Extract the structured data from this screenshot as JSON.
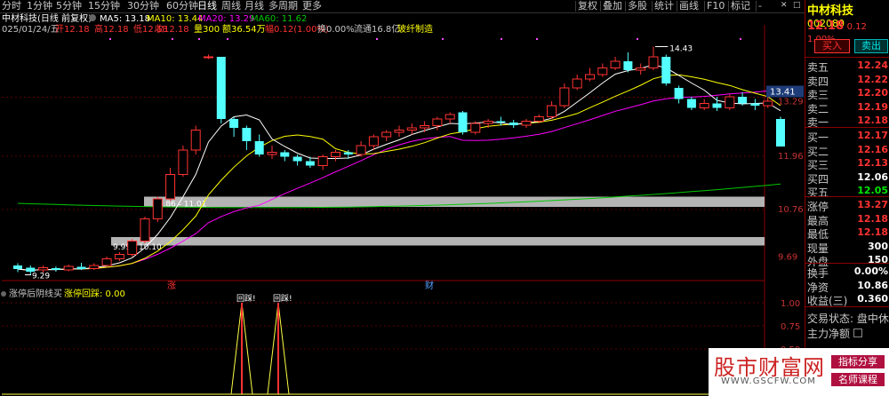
{
  "toolbar": {
    "periods": [
      "分时",
      "1分钟",
      "5分钟",
      "15分钟",
      "30分钟",
      "60分钟",
      "日线",
      "周线",
      "月线",
      "多周期",
      "更多"
    ],
    "active_period": "日线",
    "right_items": [
      "复权",
      "叠加",
      "多股",
      "统计",
      "画线",
      "F10",
      "标记",
      "-"
    ]
  },
  "stock": {
    "name": "中材科技",
    "code": "002080",
    "price": "12.18",
    "change": "0.12",
    "pct": "1.00%"
  },
  "header": {
    "title_line": "中材科技(日线 前复权)",
    "ma5": "MA5: 13.18",
    "ma10": "MA10: 13.44",
    "ma20": "MA20: 13.29",
    "ma60": "MA60: 11.62",
    "ohlc_date": "025/01/24/五",
    "ohlc_open": "开12.18",
    "ohlc_high": "高12.18",
    "ohlc_low": "低12.18",
    "ohlc_close": "收12.18",
    "ohlc_vol": "量300",
    "ohlc_amount": "额36.54万",
    "ohlc_amp": "幅0.12(1.00%)",
    "ohlc_turnover": "换0.00%",
    "ohlc_float": "流通16.8亿",
    "ohlc_sector": "玻纤制造"
  },
  "chart_labels": {
    "y_ticks": [
      "13.41",
      "13.29",
      "11.96",
      "10.76",
      "9.69"
    ],
    "high_label": "14.43",
    "low_label": "9.29",
    "zone_upper": "10.86 - 11.01",
    "zone_lower": "9.99 - 10.10",
    "marker_zhang": "涨",
    "marker_cai": "财",
    "indicator_name": "涨停后阴线买",
    "indicator_value": "涨停回踩: 0.00",
    "ind_ticks": [
      "1.00",
      "0.75",
      "0.50"
    ],
    "signal1": "回踩!",
    "signal2": "回踩!"
  },
  "colors": {
    "up": "#ff3232",
    "down": "#54ffff",
    "ma5": "#ffffff",
    "ma10": "#ffff00",
    "ma20": "#ff00ff",
    "ma60": "#00c800",
    "zone": "#b4b4b4"
  },
  "panel": {
    "buy_btn": "买入",
    "sell_btn": "卖出",
    "asks": [
      {
        "label": "卖五",
        "price": "12.24"
      },
      {
        "label": "卖四",
        "price": "12.22"
      },
      {
        "label": "卖三",
        "price": "12.20"
      },
      {
        "label": "卖二",
        "price": "12.19"
      },
      {
        "label": "卖一",
        "price": "12.18"
      }
    ],
    "bids": [
      {
        "label": "买一",
        "price": "12.17"
      },
      {
        "label": "买二",
        "price": "12.16"
      },
      {
        "label": "买三",
        "price": "12.13"
      },
      {
        "label": "买四",
        "price": "12.06"
      },
      {
        "label": "买五",
        "price": "12.05"
      }
    ],
    "stats": [
      {
        "label": "涨停",
        "value": "13.27"
      },
      {
        "label": "最高",
        "value": "12.18"
      },
      {
        "label": "最低",
        "value": "12.18"
      },
      {
        "label": "现量",
        "value": "300"
      },
      {
        "label": "外盘",
        "value": "150"
      }
    ],
    "stats2": [
      {
        "label": "换手",
        "value": "0.00%"
      },
      {
        "label": "净资",
        "value": "10.86"
      },
      {
        "label": "收益(三)",
        "value": "0.360"
      }
    ],
    "trade_status": "交易状态: 盘中休",
    "main_net": "主力净额"
  },
  "watermark": {
    "title": "股市财富网",
    "url": "WWW.GSCFW.COM",
    "tag1": "指标分享",
    "tag2": "名师课程"
  },
  "chart_data": {
    "type": "candlestick",
    "candles": [
      [
        9.5,
        9.42,
        9.55,
        9.35
      ],
      [
        9.45,
        9.36,
        9.5,
        9.29
      ],
      [
        9.4,
        9.45,
        9.5,
        9.34
      ],
      [
        9.44,
        9.4,
        9.48,
        9.36
      ],
      [
        9.4,
        9.48,
        9.52,
        9.37
      ],
      [
        9.47,
        9.42,
        9.56,
        9.4
      ],
      [
        9.43,
        9.5,
        9.55,
        9.4
      ],
      [
        9.5,
        9.65,
        9.7,
        9.48
      ],
      [
        9.65,
        9.75,
        9.8,
        9.6
      ],
      [
        9.75,
        10.05,
        10.1,
        9.7
      ],
      [
        10.05,
        10.55,
        10.6,
        10.0
      ],
      [
        10.55,
        11.0,
        11.05,
        10.48
      ],
      [
        11.0,
        11.55,
        11.7,
        10.95
      ],
      [
        11.55,
        12.1,
        12.2,
        11.5
      ],
      [
        12.1,
        12.55,
        12.65,
        12.0
      ],
      [
        14.2,
        14.2,
        14.25,
        14.15
      ],
      [
        14.2,
        12.8,
        14.05,
        12.7
      ],
      [
        12.8,
        12.6,
        12.85,
        12.4
      ],
      [
        12.6,
        12.3,
        12.65,
        12.1
      ],
      [
        12.3,
        12.0,
        12.45,
        11.95
      ],
      [
        12.0,
        12.05,
        12.2,
        11.9
      ],
      [
        12.05,
        11.95,
        12.1,
        11.85
      ],
      [
        11.95,
        11.85,
        12.0,
        11.75
      ],
      [
        11.85,
        11.75,
        11.95,
        11.7
      ],
      [
        11.75,
        11.95,
        12.0,
        11.65
      ],
      [
        11.95,
        12.05,
        12.1,
        11.85
      ],
      [
        12.05,
        12.0,
        12.1,
        11.9
      ],
      [
        12.0,
        12.2,
        12.3,
        11.95
      ],
      [
        12.2,
        12.4,
        12.45,
        12.1
      ],
      [
        12.4,
        12.5,
        12.55,
        12.3
      ],
      [
        12.5,
        12.55,
        12.65,
        12.4
      ],
      [
        12.55,
        12.6,
        12.7,
        12.45
      ],
      [
        12.6,
        12.65,
        12.75,
        12.5
      ],
      [
        12.65,
        12.8,
        12.85,
        12.55
      ],
      [
        12.8,
        12.9,
        12.95,
        12.7
      ],
      [
        12.95,
        12.5,
        12.98,
        12.45
      ],
      [
        12.5,
        12.7,
        12.75,
        12.45
      ],
      [
        12.7,
        12.75,
        12.8,
        12.6
      ],
      [
        12.75,
        12.72,
        12.85,
        12.65
      ],
      [
        12.72,
        12.66,
        12.78,
        12.6
      ],
      [
        12.66,
        12.75,
        12.8,
        12.6
      ],
      [
        12.75,
        12.85,
        12.9,
        12.7
      ],
      [
        12.85,
        13.1,
        13.2,
        12.8
      ],
      [
        13.1,
        13.5,
        13.6,
        13.05
      ],
      [
        13.5,
        13.7,
        13.8,
        13.45
      ],
      [
        13.7,
        13.8,
        13.95,
        13.65
      ],
      [
        13.8,
        13.95,
        14.05,
        13.75
      ],
      [
        13.95,
        14.1,
        14.2,
        13.9
      ],
      [
        14.1,
        13.9,
        14.3,
        13.85
      ],
      [
        13.9,
        13.95,
        14.05,
        13.8
      ],
      [
        13.95,
        14.2,
        14.43,
        13.9
      ],
      [
        14.2,
        13.6,
        14.25,
        13.55
      ],
      [
        13.5,
        13.25,
        13.55,
        13.15
      ],
      [
        13.25,
        13.05,
        13.3,
        13.0
      ],
      [
        13.05,
        13.15,
        13.25,
        13.0
      ],
      [
        13.15,
        13.05,
        13.3,
        12.98
      ],
      [
        13.05,
        13.3,
        13.35,
        13.0
      ],
      [
        13.3,
        13.15,
        13.4,
        13.1
      ],
      [
        13.15,
        13.1,
        13.25,
        13.0
      ],
      [
        13.1,
        13.2,
        13.35,
        13.05
      ],
      [
        12.8,
        12.18,
        12.85,
        12.18
      ]
    ],
    "ylim": [
      9.2,
      14.8
    ],
    "support_zones": [
      [
        10.86,
        11.01
      ],
      [
        9.99,
        10.1
      ]
    ]
  }
}
